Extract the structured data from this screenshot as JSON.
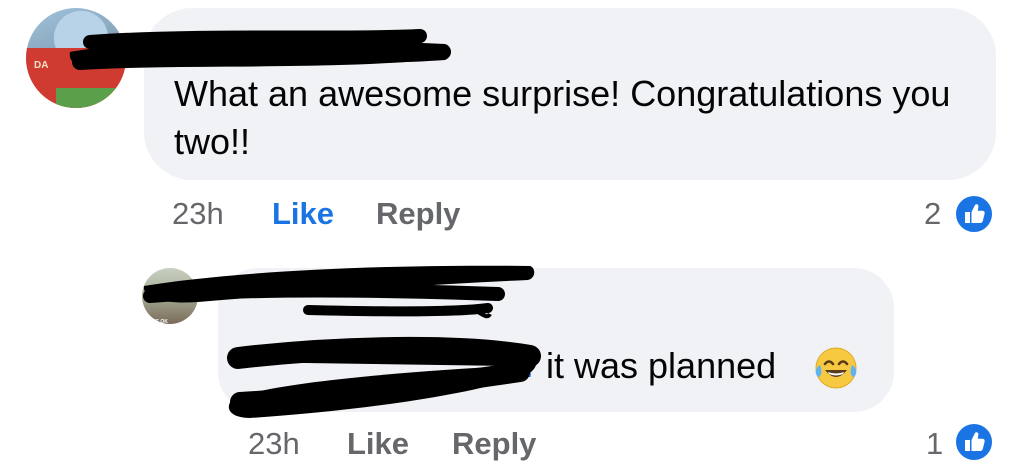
{
  "comments": [
    {
      "text": "What an awesome surprise! Congratulations you two!!",
      "time": "23h",
      "like_label": "Like",
      "reply_label": "Reply",
      "liked_by_viewer": true,
      "reaction_count": "2",
      "reaction_icon": "thumbs-up-icon",
      "author_redacted": true
    },
    {
      "text": "it was planned",
      "emoji": "face-with-tears-of-joy-icon",
      "time": "23h",
      "like_label": "Like",
      "reply_label": "Reply",
      "liked_by_viewer": false,
      "reaction_count": "1",
      "reaction_icon": "thumbs-up-icon",
      "author_redacted": true,
      "mention_redacted": true
    }
  ],
  "colors": {
    "bubble": "#f0f2f5",
    "text": "#050505",
    "meta": "#65676b",
    "accent": "#1b74e4",
    "redaction": "#000000"
  }
}
